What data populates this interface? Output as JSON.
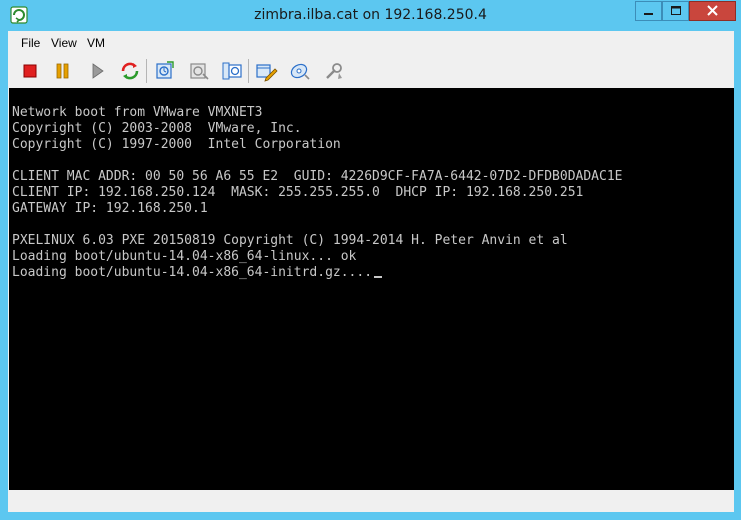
{
  "window": {
    "title": "zimbra.ilba.cat on 192.168.250.4"
  },
  "menu": {
    "items": [
      "File",
      "View",
      "VM"
    ]
  },
  "toolbar": {
    "buttons": [
      {
        "icon": "stop-icon",
        "color": "#e02020"
      },
      {
        "icon": "pause-icon",
        "color": "#e6a000"
      },
      {
        "icon": "play-icon",
        "color": "#8a8a8a"
      },
      {
        "icon": "reset-icon",
        "color": "#2b9a2b"
      },
      {
        "icon": "snapshot-icon",
        "color": "#2b6fc9"
      },
      {
        "icon": "revert-snapshot-icon",
        "color": "#8a8a8a"
      },
      {
        "icon": "snapshot-manager-icon",
        "color": "#2b6fc9"
      },
      {
        "icon": "edit-settings-icon",
        "color": "#2b6fc9"
      },
      {
        "icon": "cd-dvd-icon",
        "color": "#2b6fc9"
      },
      {
        "icon": "vm-options-icon",
        "color": "#8a8a8a"
      }
    ]
  },
  "console": {
    "lines": [
      "Network boot from VMware VMXNET3",
      "Copyright (C) 2003-2008  VMware, Inc.",
      "Copyright (C) 1997-2000  Intel Corporation",
      "",
      "CLIENT MAC ADDR: 00 50 56 A6 55 E2  GUID: 4226D9CF-FA7A-6442-07D2-DFDB0DADAC1E",
      "CLIENT IP: 192.168.250.124  MASK: 255.255.255.0  DHCP IP: 192.168.250.251",
      "GATEWAY IP: 192.168.250.1",
      "",
      "PXELINUX 6.03 PXE 20150819 Copyright (C) 1994-2014 H. Peter Anvin et al",
      "Loading boot/ubuntu-14.04-x86_64-linux... ok",
      "Loading boot/ubuntu-14.04-x86_64-initrd.gz...."
    ],
    "text_color": "#c8c8c8",
    "background": "#000000"
  },
  "colors": {
    "titlebar": "#5cc7f0",
    "close_button": "#c9463d"
  }
}
